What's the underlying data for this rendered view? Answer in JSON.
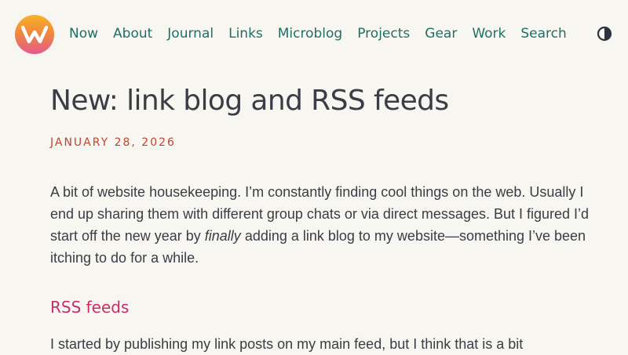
{
  "nav": {
    "items": [
      {
        "label": "Now"
      },
      {
        "label": "About"
      },
      {
        "label": "Journal"
      },
      {
        "label": "Links"
      },
      {
        "label": "Microblog"
      },
      {
        "label": "Projects"
      },
      {
        "label": "Gear"
      },
      {
        "label": "Work"
      },
      {
        "label": "Search"
      }
    ],
    "theme_toggle_icon": "contrast-half-circle-icon",
    "logo_icon": "w-monogram-logo"
  },
  "post": {
    "title": "New: link blog and RSS feeds",
    "date": "JANUARY 28, 2026",
    "paragraph1": {
      "before": "A bit of website housekeeping. I’m constantly finding cool things on the web. Usually I end up sharing them with different group chats or via direct messages. But I figured I’d start off the new year by ",
      "emphasis": "finally",
      "after": " adding a link blog to my website—something I’ve been itching to do for a while."
    },
    "subheading": "RSS feeds",
    "paragraph2": "I started by publishing my link posts on my main feed, but I think that is a bit"
  },
  "colors": {
    "background": "#f8f6f1",
    "nav_link": "#1f6f66",
    "date": "#c0452e",
    "subheading": "#c72d6c",
    "text": "#3a3d46"
  }
}
